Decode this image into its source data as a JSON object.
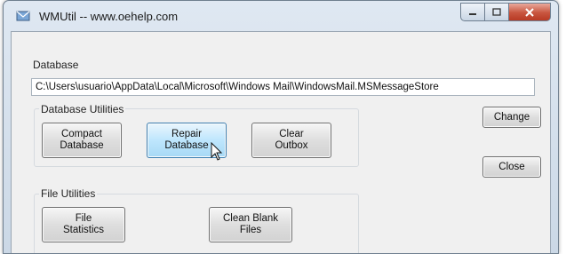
{
  "window": {
    "title": "WMUtil -- www.oehelp.com",
    "icons": {
      "app": "app-icon",
      "minimize": "minimize-icon",
      "maximize": "maximize-icon",
      "close": "close-icon"
    }
  },
  "database": {
    "label": "Database",
    "path": "C:\\Users\\usuario\\AppData\\Local\\Microsoft\\Windows Mail\\WindowsMail.MSMessageStore"
  },
  "db_utilities": {
    "label": "Database Utilities",
    "compact": "Compact\nDatabase",
    "repair": "Repair\nDatabase",
    "clear": "Clear\nOutbox"
  },
  "side_buttons": {
    "change": "Change",
    "close": "Close"
  },
  "file_utilities": {
    "label": "File Utilities",
    "stats": "File\nStatistics",
    "clean": "Clean Blank\nFiles"
  },
  "cursor": "pointer-cursor-icon"
}
